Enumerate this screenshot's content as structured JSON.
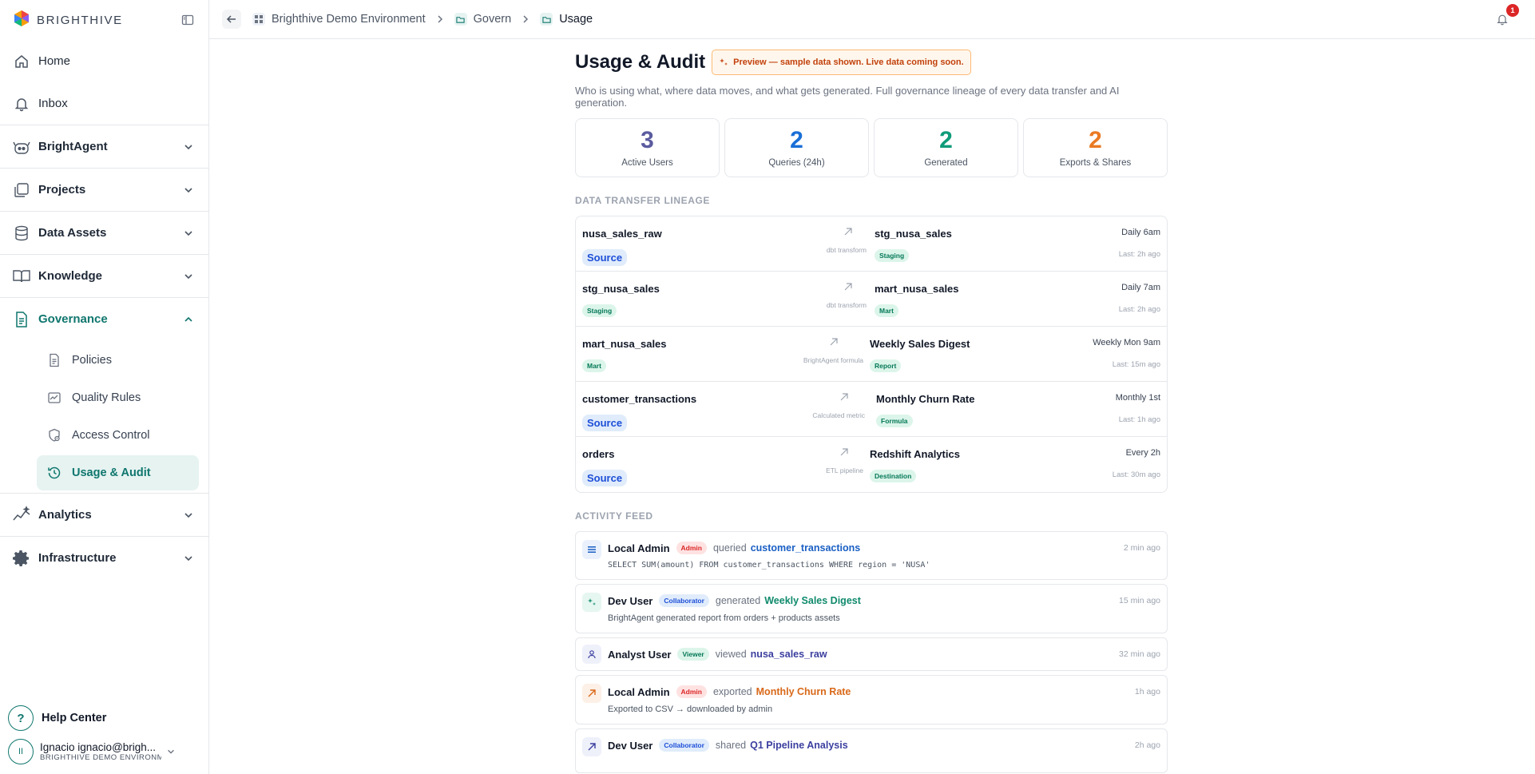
{
  "brand": {
    "name": "BRIGHTHIVE"
  },
  "sidebar": {
    "items": [
      {
        "label": "Home"
      },
      {
        "label": "Inbox"
      },
      {
        "label": "BrightAgent"
      },
      {
        "label": "Projects"
      },
      {
        "label": "Data Assets"
      },
      {
        "label": "Knowledge"
      },
      {
        "label": "Governance"
      },
      {
        "label": "Analytics"
      },
      {
        "label": "Infrastructure"
      }
    ],
    "governance_sub": [
      {
        "label": "Policies"
      },
      {
        "label": "Quality Rules"
      },
      {
        "label": "Access Control"
      },
      {
        "label": "Usage & Audit"
      }
    ],
    "help": "Help Center",
    "user": {
      "initials": "II",
      "name": "Ignacio ignacio@brigh...",
      "org": "BRIGHTHIVE DEMO ENVIRONMENT"
    }
  },
  "header": {
    "breadcrumbs": [
      "Brighthive Demo Environment",
      "Govern",
      "Usage"
    ],
    "notifications": "1"
  },
  "page": {
    "title": "Usage & Audit",
    "preview": "Preview — sample data shown. Live data coming soon.",
    "subtitle": "Who is using what, where data moves, and what gets generated. Full governance lineage of every data transfer and AI generation."
  },
  "stats": [
    {
      "value": "3",
      "label": "Active Users",
      "color": "#5b5b9f"
    },
    {
      "value": "2",
      "label": "Queries (24h)",
      "color": "#1a6fd6"
    },
    {
      "value": "2",
      "label": "Generated",
      "color": "#0f9b7a"
    },
    {
      "value": "2",
      "label": "Exports & Shares",
      "color": "#ea7a23"
    }
  ],
  "lineage": {
    "heading": "DATA TRANSFER LINEAGE",
    "rows": [
      {
        "source": "nusa_sales_raw",
        "source_tag": "Source",
        "via": "dbt transform",
        "target": "stg_nusa_sales",
        "target_tag": "Staging",
        "schedule": "Daily 6am",
        "last": "Last: 2h ago"
      },
      {
        "source": "stg_nusa_sales",
        "source_tag": "Staging",
        "via": "dbt transform",
        "target": "mart_nusa_sales",
        "target_tag": "Mart",
        "schedule": "Daily 7am",
        "last": "Last: 2h ago"
      },
      {
        "source": "mart_nusa_sales",
        "source_tag": "Mart",
        "via": "BrightAgent formula",
        "target": "Weekly Sales Digest",
        "target_tag": "Report",
        "schedule": "Weekly Mon 9am",
        "last": "Last: 15m ago"
      },
      {
        "source": "customer_transactions",
        "source_tag": "Source",
        "via": "Calculated metric",
        "target": "Monthly Churn Rate",
        "target_tag": "Formula",
        "schedule": "Monthly 1st",
        "last": "Last: 1h ago"
      },
      {
        "source": "orders",
        "source_tag": "Source",
        "via": "ETL pipeline",
        "target": "Redshift Analytics",
        "target_tag": "Destination",
        "schedule": "Every 2h",
        "last": "Last: 30m ago"
      }
    ]
  },
  "feed": {
    "heading": "ACTIVITY FEED",
    "items": [
      {
        "user": "Local Admin",
        "role": "Admin",
        "action": "queried",
        "target": "customer_transactions",
        "target_color": "#1a5fc4",
        "time": "2 min ago",
        "detail": "SELECT SUM(amount) FROM customer_transactions WHERE region = 'NUSA'",
        "icon": "list-icon"
      },
      {
        "user": "Dev User",
        "role": "Collaborator",
        "action": "generated",
        "target": "Weekly Sales Digest",
        "target_color": "#0f8a6c",
        "time": "15 min ago",
        "detail": "BrightAgent generated report from orders + products assets",
        "icon": "sparkle-icon"
      },
      {
        "user": "Analyst User",
        "role": "Viewer",
        "action": "viewed",
        "target": "nusa_sales_raw",
        "target_color": "#3b3f9f",
        "time": "32 min ago",
        "detail": "",
        "icon": "user-icon"
      },
      {
        "user": "Local Admin",
        "role": "Admin",
        "action": "exported",
        "target": "Monthly Churn Rate",
        "target_color": "#d9691a",
        "time": "1h ago",
        "detail": "Exported to CSV → downloaded by admin",
        "icon": "arrow-up-right-icon"
      },
      {
        "user": "Dev User",
        "role": "Collaborator",
        "action": "shared",
        "target": "Q1 Pipeline Analysis",
        "target_color": "#3b3f9f",
        "time": "2h ago",
        "detail": "",
        "icon": "share-icon"
      }
    ]
  }
}
